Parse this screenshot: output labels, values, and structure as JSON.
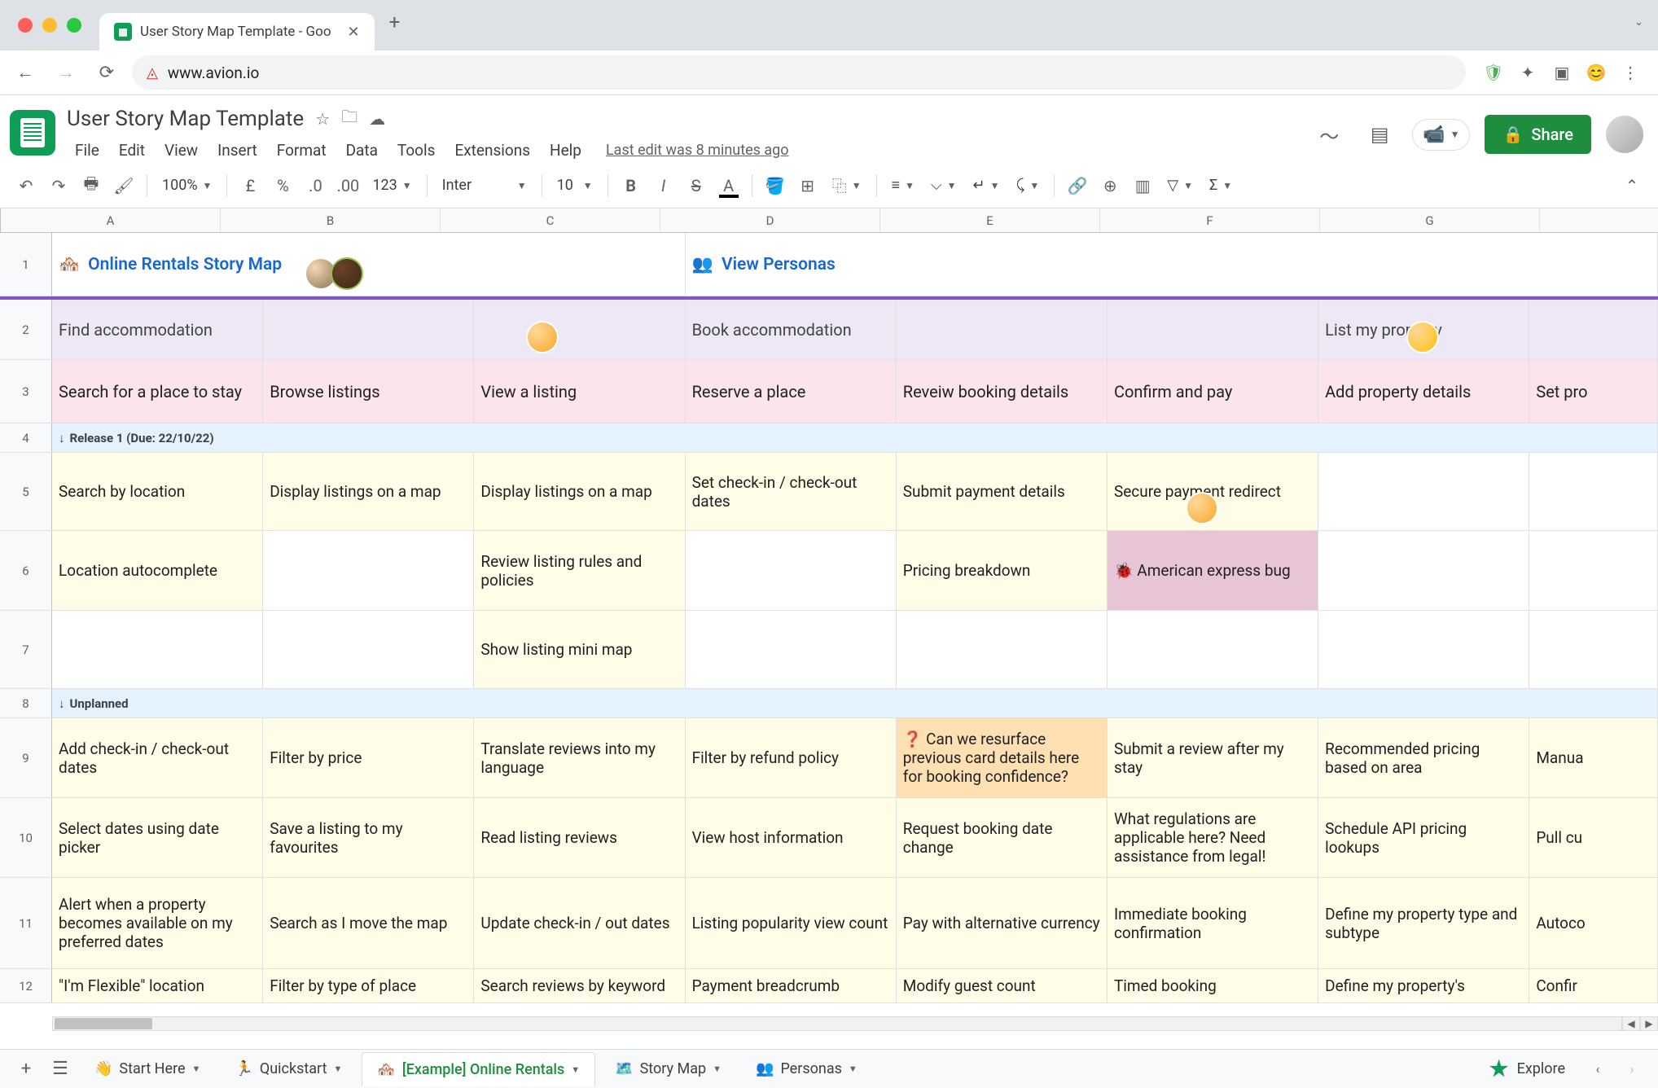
{
  "browser": {
    "tab_title": "User Story Map Template - Goo",
    "url": "www.avion.io"
  },
  "doc": {
    "title": "User Story Map Template",
    "last_edit": "Last edit was 8 minutes ago",
    "share_label": "Share"
  },
  "menus": [
    "File",
    "Edit",
    "View",
    "Insert",
    "Format",
    "Data",
    "Tools",
    "Extensions",
    "Help"
  ],
  "toolbar": {
    "zoom": "100%",
    "font": "Inter",
    "font_size": "10",
    "number_format": "123"
  },
  "columns": {
    "labels": [
      "A",
      "B",
      "C",
      "D",
      "E",
      "F",
      "G",
      ""
    ],
    "widths": [
      270,
      270,
      270,
      270,
      270,
      270,
      270,
      164
    ]
  },
  "rows": {
    "r1": {
      "title": "Online Rentals Story Map",
      "title_emoji": "🏘️",
      "personas_link": "View Personas",
      "personas_emoji": "👥"
    },
    "r2": [
      "Find accommodation",
      "",
      "",
      "Book accommodation",
      "",
      "",
      "List my property",
      ""
    ],
    "r3": [
      "Search for a place to stay",
      "Browse listings",
      "View a listing",
      "Reserve a place",
      "Reveiw booking details",
      "Confirm and pay",
      "Add property details",
      "Set pro"
    ],
    "release1_label": "Release 1 (Due: 22/10/22)",
    "r5": [
      "Search by location",
      "Display listings on a map",
      "Display listings on a map",
      "Set check-in / check-out dates",
      "Submit payment details",
      "Secure payment redirect",
      "",
      ""
    ],
    "r6": [
      "Location autocomplete",
      "",
      "Review listing rules and policies",
      "",
      "Pricing breakdown",
      "🐞  American express bug",
      "",
      ""
    ],
    "r7": [
      "",
      "",
      "Show listing mini map",
      "",
      "",
      "",
      "",
      ""
    ],
    "unplanned_label": "Unplanned",
    "r9": [
      "Add check-in / check-out dates",
      "Filter by price",
      "Translate reviews into my language",
      "Filter by refund policy",
      "❓  Can we resurface previous card details here for booking confidence?",
      "Submit a review after my stay",
      "Recommended pricing based on area",
      "Manua"
    ],
    "r10": [
      "Select dates using date picker",
      "Save a listing to my favourites",
      "Read listing reviews",
      "View host information",
      "Request booking date change",
      "What regulations are applicable here? Need assistance from legal!",
      "Schedule API pricing lookups",
      "Pull cu"
    ],
    "r11": [
      "Alert when a property becomes available on my preferred dates",
      "Search as I move the map",
      "Update check-in / out dates",
      "Listing popularity view count",
      "Pay with alternative currency",
      "Immediate booking confirmation",
      "Define my property type and subtype",
      "Autoco"
    ],
    "r12": [
      "\"I'm Flexible\" location",
      "Filter by type of place",
      "Search reviews by keyword",
      "Payment breadcrumb",
      "Modify guest count",
      "Timed booking",
      "Define my property's",
      "Confir"
    ]
  },
  "row_heights": {
    "r1": 78,
    "r2": 78,
    "r3": 78,
    "r4": 36,
    "r5": 96,
    "r6": 98,
    "r7": 96,
    "r8": 36,
    "r9": 98,
    "r10": 98,
    "r11": 112,
    "r12": 42
  },
  "card_flags": {
    "r5": [
      "c",
      "c",
      "c",
      "c",
      "c",
      "c",
      "",
      ""
    ],
    "r6": [
      "c",
      "",
      "c",
      "",
      "c",
      "bug",
      "",
      ""
    ],
    "r7": [
      "",
      "",
      "c",
      "",
      "",
      "",
      "",
      ""
    ],
    "r9": [
      "c",
      "c",
      "c",
      "c",
      "q",
      "c",
      "c",
      "c"
    ],
    "r10": [
      "c",
      "c",
      "c",
      "c",
      "c",
      "c",
      "c",
      "c"
    ],
    "r11": [
      "c",
      "c",
      "c",
      "c",
      "c",
      "c",
      "c",
      "c"
    ],
    "r12": [
      "c",
      "c",
      "c",
      "c",
      "c",
      "c",
      "c",
      "c"
    ]
  },
  "sheet_tabs": [
    {
      "emoji": "👋",
      "label": "Start Here",
      "active": false
    },
    {
      "emoji": "🏃",
      "label": "Quickstart",
      "active": false
    },
    {
      "emoji": "🏘️",
      "label": "[Example] Online Rentals",
      "active": true
    },
    {
      "emoji": "🗺️",
      "label": "Story Map",
      "active": false
    },
    {
      "emoji": "👥",
      "label": "Personas",
      "active": false
    }
  ],
  "explore_label": "Explore"
}
